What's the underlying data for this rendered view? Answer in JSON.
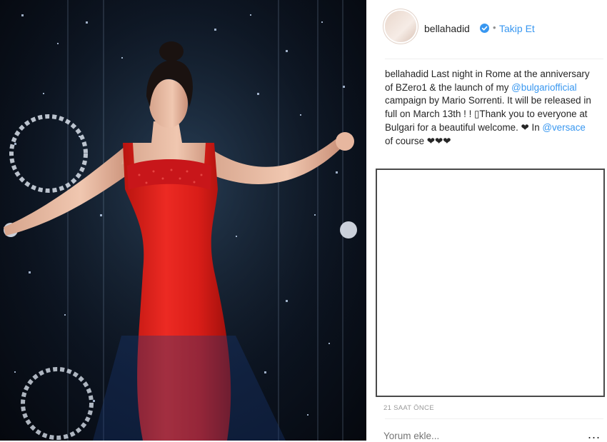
{
  "post": {
    "username": "bellahadid",
    "follow_label": "Takip Et",
    "separator": "•",
    "caption": {
      "user": "bellahadid",
      "text1": " Last night in Rome at the anniversary of BZero1 & the launch of my ",
      "mention1": "@bulgariofficial",
      "text2": " campaign by Mario Sorrenti. It will be released in full on March 13th ! ! ▯Thank you to everyone at Bulgari for a beautiful welcome. ❤ In ",
      "mention2": "@versace",
      "text3": " of course ❤❤❤"
    },
    "timestamp": "21 SAAT ÖNCE",
    "comment_placeholder": "Yorum ekle...",
    "more_label": "..."
  },
  "colors": {
    "link": "#3897f0",
    "verified": "#3897f0",
    "dress": "#e0211e"
  },
  "icons": [
    "verified-badge-icon",
    "more-options-icon"
  ]
}
